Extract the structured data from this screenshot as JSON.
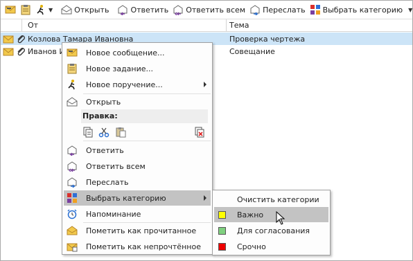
{
  "toolbar": {
    "open": "Открыть",
    "reply": "Ответить",
    "reply_all": "Ответить всем",
    "forward": "Переслать",
    "categorize": "Выбрать категорию"
  },
  "columns": {
    "from": "От",
    "subject": "Тема"
  },
  "messages": [
    {
      "from": "Козлова Тамара Ивановна",
      "subject": "Проверка чертежа",
      "selected": true
    },
    {
      "from": "Иванов И",
      "subject": "Совещание",
      "selected": false
    }
  ],
  "menu": {
    "new_message": "Новое сообщение...",
    "new_task": "Новое задание...",
    "new_assignment": "Новое поручение...",
    "open": "Открыть",
    "edit_header": "Правка:",
    "reply": "Ответить",
    "reply_all": "Ответить всем",
    "forward": "Переслать",
    "categorize": "Выбрать категорию",
    "reminder": "Напоминание",
    "mark_read": "Пометить как прочитанное",
    "mark_unread": "Пометить как непрочтённое"
  },
  "submenu": {
    "clear": "Очистить категории",
    "items": [
      {
        "label": "Важно",
        "color": "#ffff00"
      },
      {
        "label": "Для согласования",
        "color": "#7fd07f"
      },
      {
        "label": "Срочно",
        "color": "#ee0000"
      }
    ]
  }
}
